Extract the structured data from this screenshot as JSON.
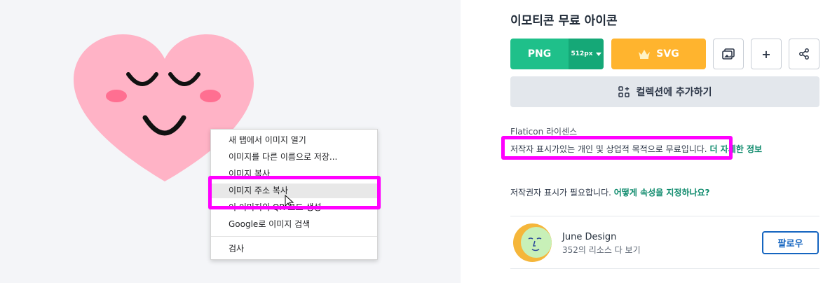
{
  "icon_title": "이모티콘 무료 아이콘",
  "context_menu": {
    "items": [
      "새 탭에서 이미지 열기",
      "이미지를 다른 이름으로 저장...",
      "이미지 복사",
      "이미지 주소 복사",
      "이 이미지의 QR 코드 생성",
      "Google로 이미지 검색",
      "검사"
    ],
    "highlighted_item": "이미지 주소 복사"
  },
  "buttons": {
    "png": "PNG",
    "png_size": "512px",
    "svg": "SVG",
    "plus": "+",
    "collection": "컬렉션에 추가하기"
  },
  "license": {
    "heading": "Flaticon 라이센스",
    "text": "저작자 표시가있는 개인 및 상업적 목적으로 무료입니다.",
    "more_link": "더 자세한 정보"
  },
  "attribution": {
    "text": "저작권자 표시가 필요합니다.",
    "link": "어떻게 속성을 지정하나요?"
  },
  "author": {
    "name": "June Design",
    "resources": "352의 리소스 다 보기",
    "follow": "팔로우"
  },
  "colors": {
    "heart": "#ffb3c6",
    "cheek": "#ff6f91",
    "highlight": "#ff00ff",
    "png_green": "#1fc08a",
    "svg_orange": "#ffb42e",
    "link_green": "#0f8b6d",
    "follow_blue": "#1565c0"
  }
}
